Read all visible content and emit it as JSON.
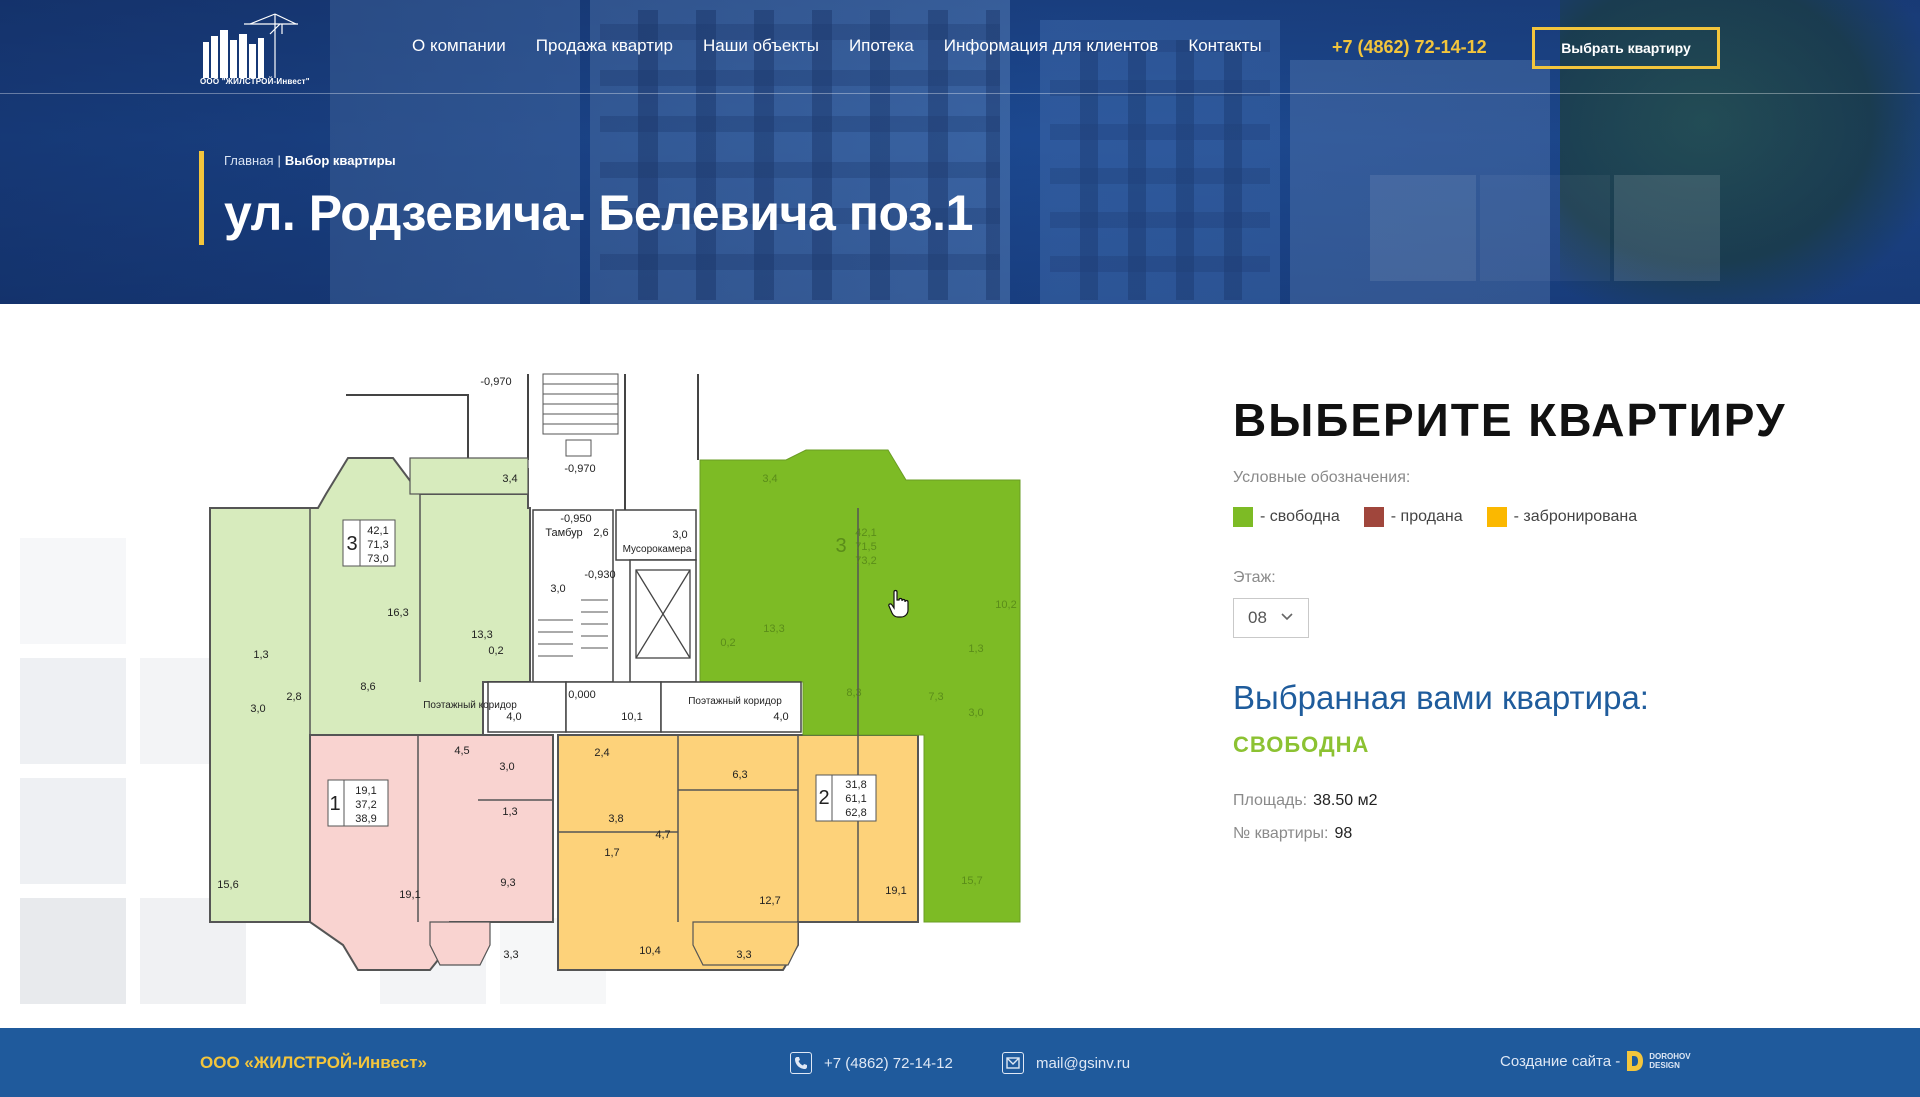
{
  "header": {
    "logo_text": "ООО \"ЖИЛСТРОЙ-Инвест\"",
    "nav": [
      {
        "label": "О компании"
      },
      {
        "label": "Продажа квартир"
      },
      {
        "label": "Наши объекты"
      },
      {
        "label": "Ипотека"
      },
      {
        "label": "Информация для клиентов"
      },
      {
        "label": "Контакты"
      }
    ],
    "phone": "+7 (4862) 72-14-12",
    "cta_label": "Выбрать квартиру"
  },
  "hero": {
    "breadcrumb": {
      "home": "Главная",
      "separator": "|",
      "current": "Выбор квартиры"
    },
    "title": "ул. Родзевича- Белевича поз.1"
  },
  "plan": {
    "marks": {
      "m_0970_top": "-0,970",
      "m_0970": "-0,970",
      "m_0950": "-0,950",
      "m_0930": "-0,930",
      "m_0000": "0,000",
      "tambur": "Тамбур",
      "tambur_area": "2,6",
      "musor": "Мусорокамера",
      "musor_area": "3,0",
      "corr_left": "Поэтажный коридор",
      "corr_right": "Поэтажный коридор",
      "stair_area": "3,0",
      "corr_left_area": "4,0",
      "corr_mid_area": "10,1",
      "corr_right_area": "4,0"
    },
    "apartments": [
      {
        "id": "A",
        "status": "free",
        "rooms": "3",
        "areas": [
          "42,1",
          "71,3",
          "73,0"
        ],
        "labels": [
          "3,4",
          "16,3",
          "13,3",
          "0,2",
          "1,3",
          "3,0",
          "2,8",
          "8,6",
          "15,6"
        ]
      },
      {
        "id": "B",
        "status": "sold",
        "rooms": "1",
        "areas": [
          "19,1",
          "37,2",
          "38,9"
        ],
        "labels": [
          "4,5",
          "3,0",
          "1,3",
          "9,3",
          "19,1",
          "3,3"
        ]
      },
      {
        "id": "C",
        "status": "reserved",
        "rooms": "2",
        "areas": [
          "31,8",
          "61,1",
          "62,8"
        ],
        "labels": [
          "2,4",
          "3,8",
          "1,7",
          "4,7",
          "6,3",
          "12,7",
          "19,1",
          "10,4",
          "3,3"
        ]
      },
      {
        "id": "D",
        "status": "free",
        "rooms": "3",
        "areas": [
          "42,1",
          "71,5",
          "73,2"
        ],
        "labels": [
          "3,4",
          "13,3",
          "0,2",
          "8,3",
          "7,3",
          "1,3",
          "3,0",
          "10,2",
          "15,7"
        ]
      }
    ]
  },
  "panel": {
    "title": "ВЫБЕРИТЕ КВАРТИРУ",
    "legend_caption": "Условные обозначения:",
    "legend": [
      {
        "label": "- свободна",
        "color": "#7dbb25"
      },
      {
        "label": "- продана",
        "color": "#a0463c"
      },
      {
        "label": "- забронирована",
        "color": "#fbb800"
      }
    ],
    "floor_caption": "Этаж:",
    "floor_value": "08",
    "selected_title": "Выбранная вами квартира:",
    "selected_status": "СВОБОДНА",
    "area_label": "Площадь:",
    "area_value": "38.50 м2",
    "number_label": "№ квартиры:",
    "number_value": "98"
  },
  "colors": {
    "free": "#7dbb25",
    "free_light": "#d7ebbd",
    "sold": "#f9d3d0",
    "reserved": "#fdd27a",
    "accent": "#f3c53c",
    "brand_blue": "#1f5a9c"
  },
  "footer": {
    "company": "ООО «ЖИЛСТРОЙ-Инвест»",
    "phone": "+7 (4862) 72-14-12",
    "email": "mail@gsinv.ru",
    "credit_label": "Создание сайта -",
    "credit_brand_line1": "DOROHOV",
    "credit_brand_line2": "DESIGN"
  }
}
